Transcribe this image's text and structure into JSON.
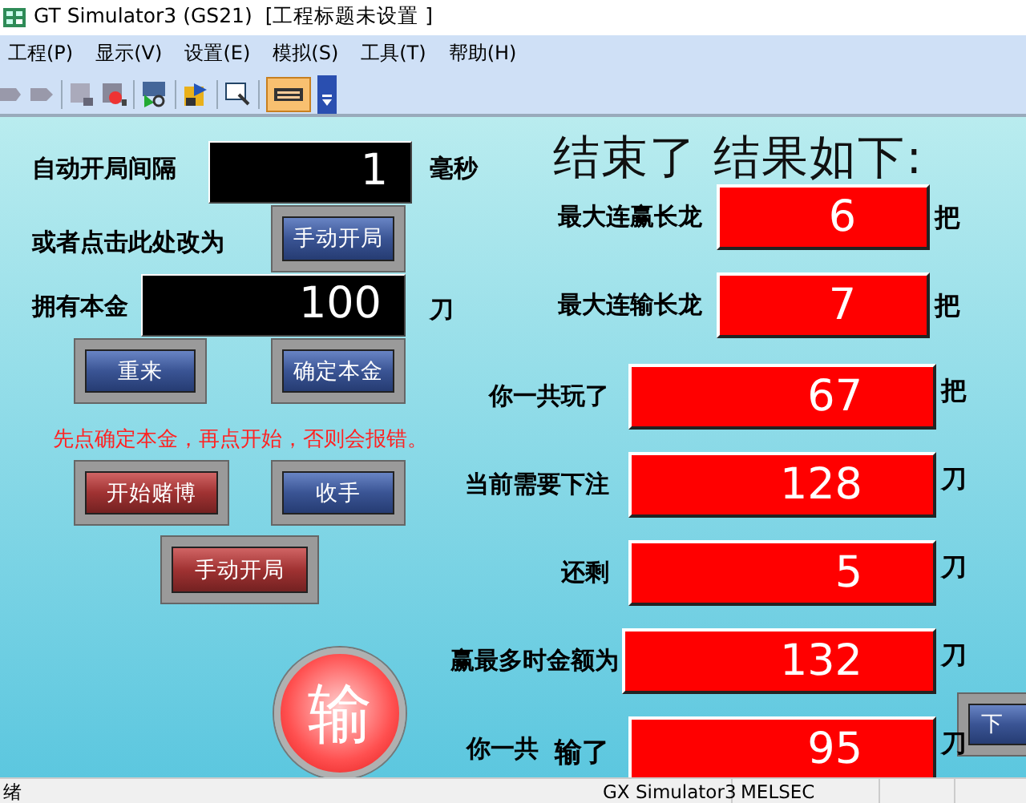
{
  "window": {
    "title": "GT Simulator3 (GS21)  [工程标题未设置 ]"
  },
  "menu": [
    "工程(P)",
    "显示(V)",
    "设置(E)",
    "模拟(S)",
    "工具(T)",
    "帮助(H)"
  ],
  "screen": {
    "labels": [
      "自动开局间隔",
      "毫秒",
      "或者点击此处改为",
      "拥有本金",
      "刀"
    ],
    "fields": [
      "1",
      "100"
    ],
    "note": "先点确定本金，再点开始，否则会报错。",
    "buttons": [
      {
        "label": "手动开局",
        "kind": "blue"
      },
      {
        "label": "重来",
        "kind": "blue"
      },
      {
        "label": "确定本金",
        "kind": "blue"
      },
      {
        "label": "开始赌博",
        "kind": "red"
      },
      {
        "label": "收手",
        "kind": "blue"
      },
      {
        "label": "手动开局",
        "kind": "red"
      },
      {
        "label": "输",
        "kind": "round"
      },
      {
        "label": "下",
        "kind": "blue"
      }
    ],
    "result_title": "结束了 结果如下:",
    "results": [
      {
        "label": "最大连赢长龙",
        "value": "6",
        "unit": "把"
      },
      {
        "label": "最大连输长龙",
        "value": "7",
        "unit": "把"
      },
      {
        "label": "你一共玩了",
        "value": "67",
        "unit": "把"
      },
      {
        "label": "当前需要下注",
        "value": "128",
        "unit": "刀"
      },
      {
        "label": "还剩",
        "value": "5",
        "unit": "刀"
      },
      {
        "label": "赢最多时金额为",
        "value": "132",
        "unit": "刀"
      },
      {
        "label": "你一共",
        "label_2": "输了",
        "value": "95",
        "unit": "刀"
      }
    ]
  },
  "status_bar": [
    "绪",
    "GX Simulator3",
    "MELSEC"
  ]
}
